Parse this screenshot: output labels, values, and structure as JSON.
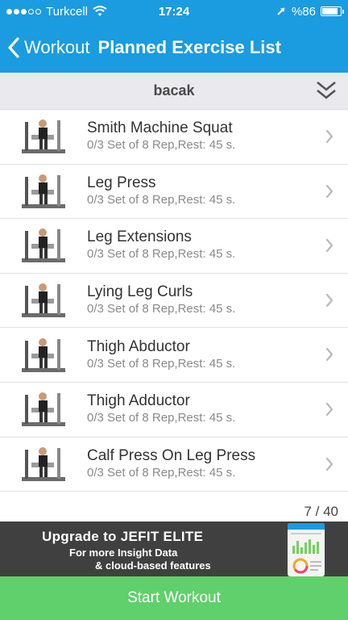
{
  "status_bar": {
    "carrier": "Turkcell",
    "time": "17:24",
    "battery": "%86",
    "battery_level": 0.86
  },
  "nav": {
    "back_label": "Workout",
    "title": "Planned Exercise List"
  },
  "group": {
    "name": "bacak"
  },
  "exercises": [
    {
      "name": "Smith Machine Squat",
      "detail": "0/3 Set of 8 Rep,Rest: 45 s."
    },
    {
      "name": "Leg Press",
      "detail": "0/3 Set of 8 Rep,Rest: 45 s."
    },
    {
      "name": "Leg Extensions",
      "detail": "0/3 Set of 8 Rep,Rest: 45 s."
    },
    {
      "name": "Lying Leg Curls",
      "detail": "0/3 Set of 8 Rep,Rest: 45 s."
    },
    {
      "name": "Thigh Abductor",
      "detail": "0/3 Set of 8 Rep,Rest: 45 s."
    },
    {
      "name": "Thigh Adductor",
      "detail": "0/3 Set of 8 Rep,Rest: 45 s."
    },
    {
      "name": "Calf Press On Leg Press",
      "detail": "0/3 Set of 8 Rep,Rest: 45 s."
    }
  ],
  "page_counter": "7 / 40",
  "banner": {
    "line1": "Upgrade to JEFIT ELITE",
    "line2": "For more Insight Data",
    "line3": "& cloud-based features"
  },
  "start_button": "Start Workout",
  "colors": {
    "header": "#1b9be0",
    "start_button": "#5fd06b",
    "banner": "#404040"
  }
}
